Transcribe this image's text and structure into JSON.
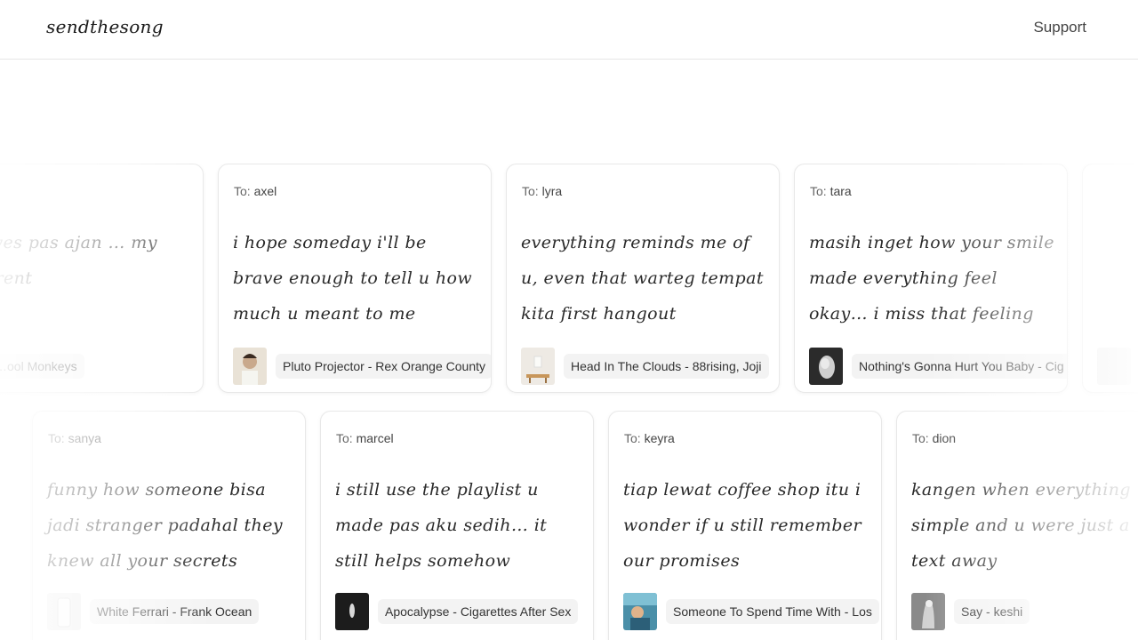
{
  "header": {
    "logo": "sendthesong",
    "support_label": "Support"
  },
  "to_prefix": "To:",
  "row1": [
    {
      "recipient": "",
      "message": "… drives pas ajan … my mind rent",
      "song": "…ool Monkeys",
      "cover_color": "#d9d9d9"
    },
    {
      "recipient": "axel",
      "message": "i hope someday i'll be brave enough to tell u how much u meant to me",
      "song": "Pluto Projector - Rex Orange County",
      "cover_color": "#e9e2d6"
    },
    {
      "recipient": "lyra",
      "message": "everything reminds me of u, even that warteg tempat kita first hangout",
      "song": "Head In The Clouds - 88rising, Joji",
      "cover_color": "#eeeae4"
    },
    {
      "recipient": "tara",
      "message": "masih inget how your smile made everything feel okay… i miss that feeling",
      "song": "Nothing's Gonna Hurt You Baby - Cig",
      "cover_color": "#2b2b2b"
    }
  ],
  "row2": [
    {
      "recipient": "sanya",
      "message": "funny how someone bisa jadi stranger padahal they knew all your secrets",
      "song": "White Ferrari - Frank Ocean",
      "cover_color": "#ececec"
    },
    {
      "recipient": "marcel",
      "message": "i still use the playlist u made pas aku sedih… it still helps somehow",
      "song": "Apocalypse - Cigarettes After Sex",
      "cover_color": "#1c1c1c"
    },
    {
      "recipient": "keyra",
      "message": "tiap lewat coffee shop itu i wonder if u still remember our promises",
      "song": "Someone To Spend Time With - Los",
      "cover_color": "#4a8fa8"
    },
    {
      "recipient": "dion",
      "message": "kangen when everything simple and u were just a text away",
      "song": "Say - keshi",
      "cover_color": "#8a8a8a"
    }
  ]
}
